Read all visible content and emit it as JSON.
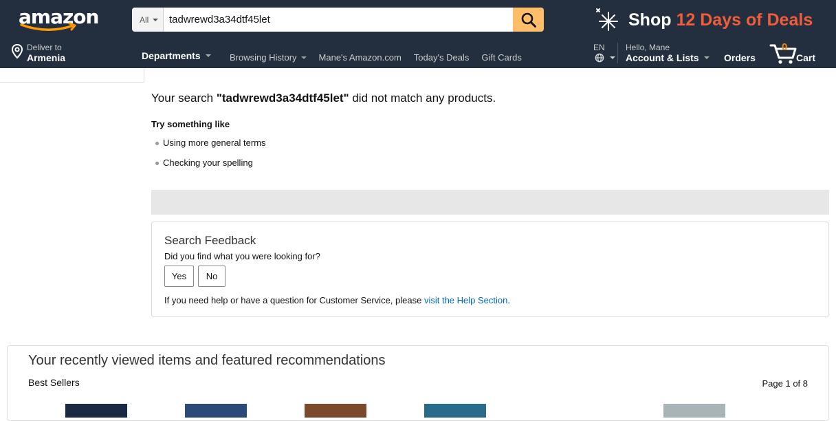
{
  "header": {
    "logo_text": "amazon",
    "search": {
      "category": "All",
      "value": "tadwrewd3a34dtf45let"
    },
    "promo": {
      "shop": "Shop",
      "deals": "12 Days of Deals"
    },
    "deliver": {
      "label": "Deliver to",
      "location": "Armenia"
    },
    "departments": "Departments",
    "nav_links": [
      "Browsing History",
      "Mane's Amazon.com",
      "Today's Deals",
      "Gift Cards"
    ],
    "language": "EN",
    "account": {
      "greeting": "Hello, Mane",
      "label": "Account & Lists"
    },
    "orders": "Orders",
    "cart": {
      "count": "0",
      "label": "Cart"
    }
  },
  "results": {
    "prefix": "Your search ",
    "term": "\"tadwrewd3a34dtf45let\"",
    "suffix": " did not match any products.",
    "try_title": "Try something like",
    "tips": [
      "Using more general terms",
      "Checking your spelling"
    ]
  },
  "feedback": {
    "title": "Search Feedback",
    "question": "Did you find what you were looking for?",
    "yes": "Yes",
    "no": "No",
    "help_prefix": "If you need help or have a question for Customer Service, please ",
    "help_link": "visit the Help Section",
    "help_suffix": "."
  },
  "recommendations": {
    "title": "Your recently viewed items and featured recommendations",
    "subtitle": "Best Sellers",
    "page": "Page 1 of 8",
    "thumbs": [
      {
        "color": "#1b2a44"
      },
      {
        "color": "#2b4a7a"
      },
      {
        "color": "#7a4a2a"
      },
      {
        "color": "#2a6a8a"
      },
      {
        "color": "#ffffff"
      },
      {
        "color": "#a8b4b8"
      }
    ]
  },
  "colors": {
    "header_bg": "#232f3e",
    "search_button": "#febd69",
    "deals_accent": "#f05d3a",
    "cart_count": "#f08804",
    "link": "#0066c0"
  }
}
